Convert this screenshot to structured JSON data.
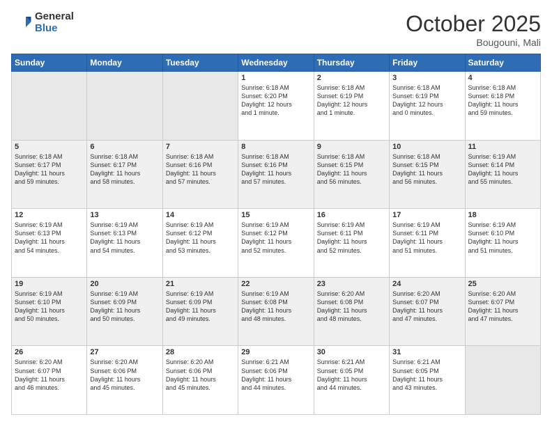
{
  "header": {
    "logo_general": "General",
    "logo_blue": "Blue",
    "month_title": "October 2025",
    "location": "Bougouni, Mali"
  },
  "weekdays": [
    "Sunday",
    "Monday",
    "Tuesday",
    "Wednesday",
    "Thursday",
    "Friday",
    "Saturday"
  ],
  "weeks": [
    [
      {
        "day": "",
        "content": ""
      },
      {
        "day": "",
        "content": ""
      },
      {
        "day": "",
        "content": ""
      },
      {
        "day": "1",
        "content": "Sunrise: 6:18 AM\nSunset: 6:20 PM\nDaylight: 12 hours\nand 1 minute."
      },
      {
        "day": "2",
        "content": "Sunrise: 6:18 AM\nSunset: 6:19 PM\nDaylight: 12 hours\nand 1 minute."
      },
      {
        "day": "3",
        "content": "Sunrise: 6:18 AM\nSunset: 6:19 PM\nDaylight: 12 hours\nand 0 minutes."
      },
      {
        "day": "4",
        "content": "Sunrise: 6:18 AM\nSunset: 6:18 PM\nDaylight: 11 hours\nand 59 minutes."
      }
    ],
    [
      {
        "day": "5",
        "content": "Sunrise: 6:18 AM\nSunset: 6:17 PM\nDaylight: 11 hours\nand 59 minutes."
      },
      {
        "day": "6",
        "content": "Sunrise: 6:18 AM\nSunset: 6:17 PM\nDaylight: 11 hours\nand 58 minutes."
      },
      {
        "day": "7",
        "content": "Sunrise: 6:18 AM\nSunset: 6:16 PM\nDaylight: 11 hours\nand 57 minutes."
      },
      {
        "day": "8",
        "content": "Sunrise: 6:18 AM\nSunset: 6:16 PM\nDaylight: 11 hours\nand 57 minutes."
      },
      {
        "day": "9",
        "content": "Sunrise: 6:18 AM\nSunset: 6:15 PM\nDaylight: 11 hours\nand 56 minutes."
      },
      {
        "day": "10",
        "content": "Sunrise: 6:18 AM\nSunset: 6:15 PM\nDaylight: 11 hours\nand 56 minutes."
      },
      {
        "day": "11",
        "content": "Sunrise: 6:19 AM\nSunset: 6:14 PM\nDaylight: 11 hours\nand 55 minutes."
      }
    ],
    [
      {
        "day": "12",
        "content": "Sunrise: 6:19 AM\nSunset: 6:13 PM\nDaylight: 11 hours\nand 54 minutes."
      },
      {
        "day": "13",
        "content": "Sunrise: 6:19 AM\nSunset: 6:13 PM\nDaylight: 11 hours\nand 54 minutes."
      },
      {
        "day": "14",
        "content": "Sunrise: 6:19 AM\nSunset: 6:12 PM\nDaylight: 11 hours\nand 53 minutes."
      },
      {
        "day": "15",
        "content": "Sunrise: 6:19 AM\nSunset: 6:12 PM\nDaylight: 11 hours\nand 52 minutes."
      },
      {
        "day": "16",
        "content": "Sunrise: 6:19 AM\nSunset: 6:11 PM\nDaylight: 11 hours\nand 52 minutes."
      },
      {
        "day": "17",
        "content": "Sunrise: 6:19 AM\nSunset: 6:11 PM\nDaylight: 11 hours\nand 51 minutes."
      },
      {
        "day": "18",
        "content": "Sunrise: 6:19 AM\nSunset: 6:10 PM\nDaylight: 11 hours\nand 51 minutes."
      }
    ],
    [
      {
        "day": "19",
        "content": "Sunrise: 6:19 AM\nSunset: 6:10 PM\nDaylight: 11 hours\nand 50 minutes."
      },
      {
        "day": "20",
        "content": "Sunrise: 6:19 AM\nSunset: 6:09 PM\nDaylight: 11 hours\nand 50 minutes."
      },
      {
        "day": "21",
        "content": "Sunrise: 6:19 AM\nSunset: 6:09 PM\nDaylight: 11 hours\nand 49 minutes."
      },
      {
        "day": "22",
        "content": "Sunrise: 6:19 AM\nSunset: 6:08 PM\nDaylight: 11 hours\nand 48 minutes."
      },
      {
        "day": "23",
        "content": "Sunrise: 6:20 AM\nSunset: 6:08 PM\nDaylight: 11 hours\nand 48 minutes."
      },
      {
        "day": "24",
        "content": "Sunrise: 6:20 AM\nSunset: 6:07 PM\nDaylight: 11 hours\nand 47 minutes."
      },
      {
        "day": "25",
        "content": "Sunrise: 6:20 AM\nSunset: 6:07 PM\nDaylight: 11 hours\nand 47 minutes."
      }
    ],
    [
      {
        "day": "26",
        "content": "Sunrise: 6:20 AM\nSunset: 6:07 PM\nDaylight: 11 hours\nand 46 minutes."
      },
      {
        "day": "27",
        "content": "Sunrise: 6:20 AM\nSunset: 6:06 PM\nDaylight: 11 hours\nand 45 minutes."
      },
      {
        "day": "28",
        "content": "Sunrise: 6:20 AM\nSunset: 6:06 PM\nDaylight: 11 hours\nand 45 minutes."
      },
      {
        "day": "29",
        "content": "Sunrise: 6:21 AM\nSunset: 6:06 PM\nDaylight: 11 hours\nand 44 minutes."
      },
      {
        "day": "30",
        "content": "Sunrise: 6:21 AM\nSunset: 6:05 PM\nDaylight: 11 hours\nand 44 minutes."
      },
      {
        "day": "31",
        "content": "Sunrise: 6:21 AM\nSunset: 6:05 PM\nDaylight: 11 hours\nand 43 minutes."
      },
      {
        "day": "",
        "content": ""
      }
    ]
  ]
}
